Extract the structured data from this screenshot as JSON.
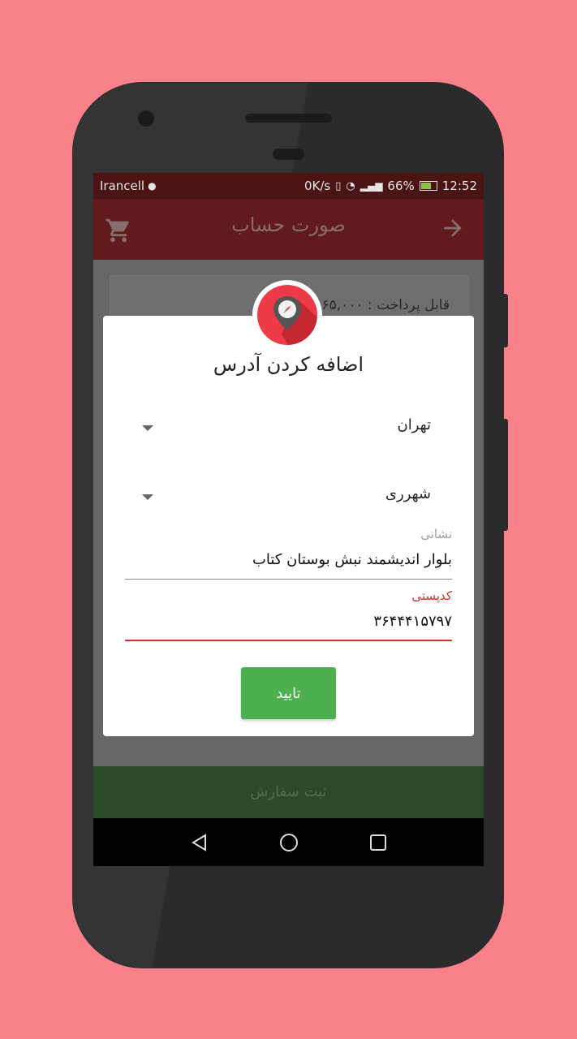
{
  "statusbar": {
    "carrier": "Irancell",
    "speed": "0K/s",
    "battery": "66%",
    "time": "12:52"
  },
  "appbar": {
    "title": "صورت حساب",
    "icons": [
      "cart-icon",
      "arrow-right-icon"
    ]
  },
  "summary": {
    "payable": "قابل پرداخت : ۶۵,۰۰۰"
  },
  "dialog": {
    "title": "اضافه کردن آدرس",
    "province": "تهران",
    "city": "شهرری",
    "address_label": "نشانی",
    "address_value": "بلوار اندیشمند نبش بوستان کتاب",
    "postal_label": "کدپستی",
    "postal_value": "۳۶۴۴۴۱۵۷۹۷",
    "confirm_label": "تایید",
    "badge_icon": "location-compass-icon"
  },
  "bottom_button": {
    "label": "ثبت سفارش"
  },
  "colors": {
    "background": "#f98189",
    "accent": "#ee3a46",
    "confirm": "#4caf50",
    "active_underline": "#d32f2f"
  }
}
